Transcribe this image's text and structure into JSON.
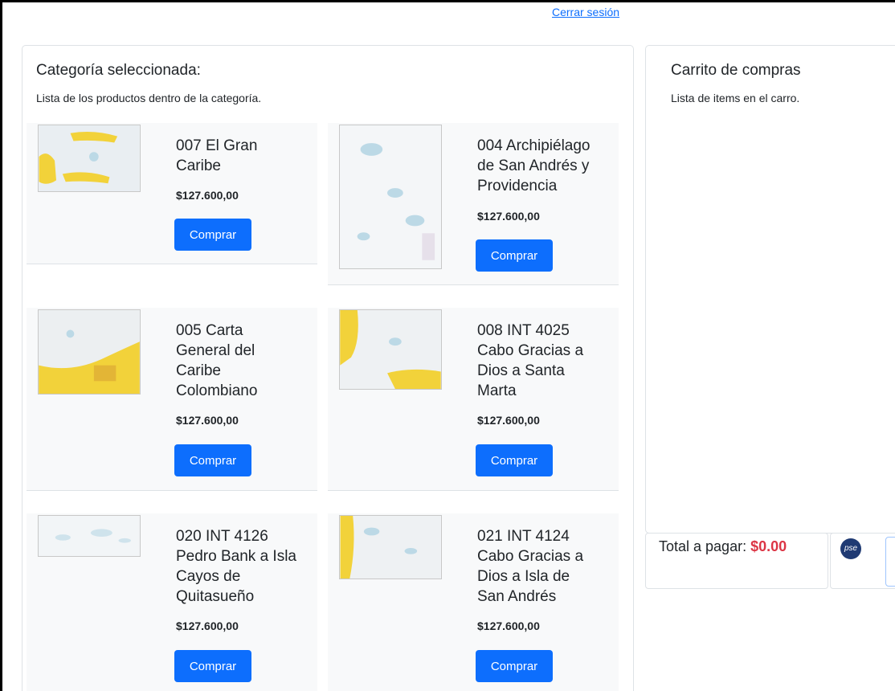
{
  "header": {
    "logout_label": "Cerrar sesión"
  },
  "catalog": {
    "title": "Categoría seleccionada:",
    "subtitle": "Lista de los productos dentro de la categoría.",
    "buy_label": "Comprar",
    "products": [
      {
        "name": "007 El Gran Caribe",
        "price": "$127.600,00"
      },
      {
        "name": "004 Archipiélago de San Andrés y Providencia",
        "price": "$127.600,00"
      },
      {
        "name": "005 Carta General del Caribe Colombiano",
        "price": "$127.600,00"
      },
      {
        "name": "008 INT 4025 Cabo Gracias a Dios a Santa Marta",
        "price": "$127.600,00"
      },
      {
        "name": "020 INT 4126 Pedro Bank a Isla Cayos de Quitasueño",
        "price": "$127.600,00"
      },
      {
        "name": "021 INT 4124 Cabo Gracias a Dios a Isla de San Andrés",
        "price": "$127.600,00"
      }
    ]
  },
  "cart": {
    "title": "Carrito de compras",
    "subtitle": "Lista de items en el carro.",
    "total_label": "Total a pagar:",
    "total_value": "$0.00"
  },
  "payment": {
    "logo_text": "pse"
  },
  "colors": {
    "primary": "#0d6efd",
    "danger": "#dc3545",
    "chart_yellow": "#f2d23a",
    "card_bg": "#f8f9fa"
  }
}
